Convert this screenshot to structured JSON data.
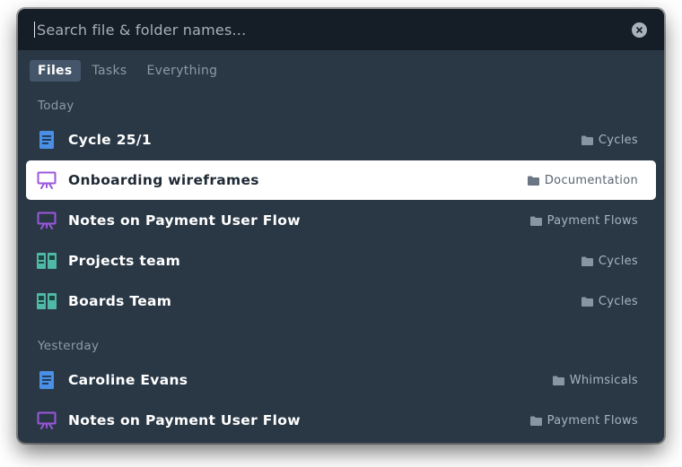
{
  "search": {
    "placeholder": "Search file & folder names...",
    "value": ""
  },
  "tabs": [
    {
      "label": "Files",
      "active": true
    },
    {
      "label": "Tasks",
      "active": false
    },
    {
      "label": "Everything",
      "active": false
    }
  ],
  "sections": [
    {
      "label": "Today",
      "items": [
        {
          "title": "Cycle 25/1",
          "icon": "document-icon",
          "folder": "Cycles",
          "selected": false
        },
        {
          "title": "Onboarding wireframes",
          "icon": "whiteboard-icon",
          "folder": "Documentation",
          "selected": true
        },
        {
          "title": "Notes on Payment User Flow",
          "icon": "whiteboard-icon",
          "folder": "Payment Flows",
          "selected": false
        },
        {
          "title": "Projects team",
          "icon": "board-icon",
          "folder": "Cycles",
          "selected": false
        },
        {
          "title": "Boards Team",
          "icon": "board-icon",
          "folder": "Cycles",
          "selected": false
        }
      ]
    },
    {
      "label": "Yesterday",
      "items": [
        {
          "title": "Caroline Evans",
          "icon": "document-icon",
          "folder": "Whimsicals",
          "selected": false
        },
        {
          "title": "Notes on Payment User Flow",
          "icon": "whiteboard-icon",
          "folder": "Payment Flows",
          "selected": false
        }
      ]
    }
  ],
  "colors": {
    "document": "#4a8fe3",
    "whiteboard": "#9a57dc",
    "board": "#4fb8a6",
    "panel": "#2a3846",
    "search_bar": "#151d26"
  }
}
